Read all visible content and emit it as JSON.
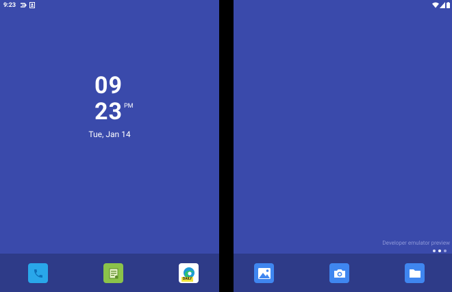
{
  "status_bar": {
    "time": "9:23",
    "left_icons": [
      "network-speed-icon",
      "notification-icon"
    ],
    "right_icons": [
      "wifi-icon",
      "cell-signal-icon",
      "battery-icon"
    ]
  },
  "clock": {
    "hour": "09",
    "minute": "23",
    "ampm": "PM",
    "date": "Tue, Jan 14"
  },
  "dock_left": [
    {
      "name": "phone-icon",
      "color": "#29a7ea"
    },
    {
      "name": "android-notes-icon",
      "color": "#8bc34a"
    },
    {
      "name": "edge-daily-icon",
      "color": "#ffffff",
      "badge": "DAILY"
    }
  ],
  "dock_right": [
    {
      "name": "gallery-icon",
      "color": "#3f86f0"
    },
    {
      "name": "camera-icon",
      "color": "#3f86f0"
    },
    {
      "name": "files-icon",
      "color": "#3f86f0"
    }
  ],
  "watermark": "Developer emulator preview",
  "pagination": {
    "count": 3,
    "active": 1
  },
  "colors": {
    "wallpaper": "#3a4aab",
    "dock": "#2e3b88"
  }
}
